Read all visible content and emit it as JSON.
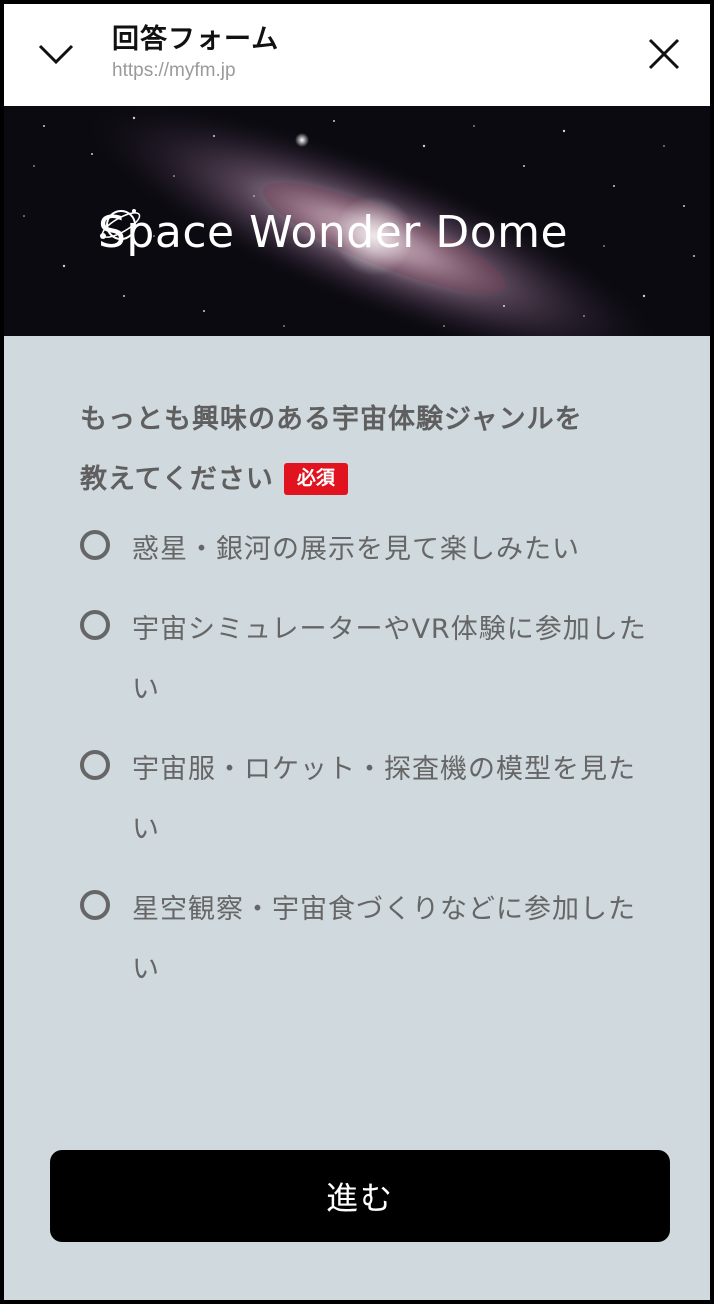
{
  "header": {
    "title": "回答フォーム",
    "url": "https://myfm.jp",
    "collapse_icon": "chevron-down-icon",
    "close_icon": "close-icon"
  },
  "hero": {
    "brand_name": "Space Wonder Dome",
    "logo_icon": "orbit-logo-icon"
  },
  "question": {
    "text_line1": "もっとも興味のある宇宙体験ジャンルを",
    "text_line2": "教えてください",
    "required_label": "必須",
    "required_color": "#e0131f"
  },
  "options": [
    {
      "label": "惑星・銀河の展示を見て楽しみたい",
      "selected": false
    },
    {
      "label": "宇宙シミュレーターやVR体験に参加したい",
      "selected": false
    },
    {
      "label": "宇宙服・ロケット・探査機の模型を見たい",
      "selected": false
    },
    {
      "label": "星空観察・宇宙食づくりなどに参加したい",
      "selected": false
    }
  ],
  "submit": {
    "label": "進む"
  },
  "colors": {
    "background": "#d0d9de",
    "button": "#000000",
    "text": "#666666"
  }
}
